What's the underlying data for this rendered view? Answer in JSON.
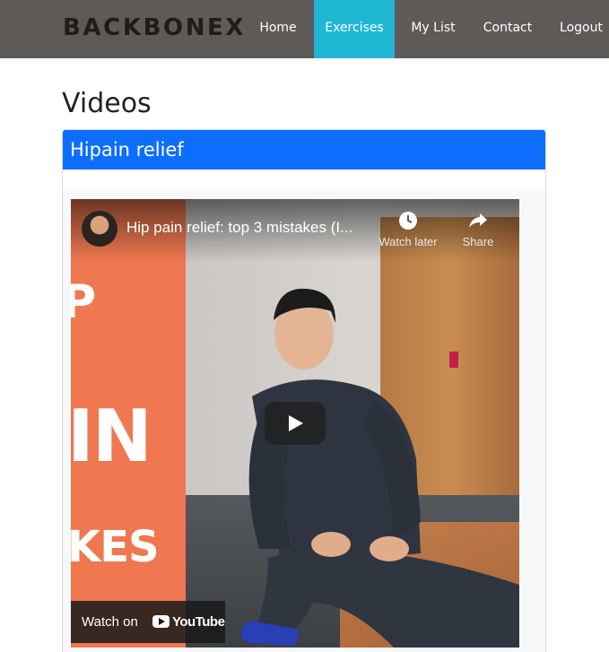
{
  "navbar": {
    "brand": "BACKBONEX",
    "items": [
      {
        "label": "Home",
        "active": false
      },
      {
        "label": "Exercises",
        "active": true
      },
      {
        "label": "My List",
        "active": false
      },
      {
        "label": "Contact",
        "active": false
      },
      {
        "label": "Logout",
        "active": false
      }
    ],
    "colors": {
      "background": "#5e5a58",
      "active": "#1fb7d4"
    }
  },
  "page": {
    "title": "Videos"
  },
  "card": {
    "header": "Hipain relief",
    "header_color": "#0d6efd",
    "video": {
      "title": "Hip pain relief: top 3 mistakes (I...",
      "actions": [
        {
          "label": "Watch later",
          "icon": "clock-icon"
        },
        {
          "label": "Share",
          "icon": "share-icon"
        }
      ],
      "thumbnail_text": [
        "P",
        "IN",
        "KES"
      ],
      "play_icon": "play-icon",
      "watch_on": "Watch on",
      "platform": "YouTube"
    }
  }
}
